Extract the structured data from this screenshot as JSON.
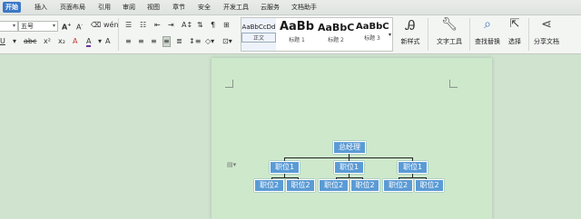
{
  "menu": {
    "items": [
      "开始",
      "插入",
      "页面布局",
      "引用",
      "审阅",
      "视图",
      "章节",
      "安全",
      "开发工具",
      "云服务",
      "文档助手"
    ],
    "active": "开始"
  },
  "ribbon": {
    "font_size": "五号",
    "styles": [
      {
        "preview": "AaBbCcDd",
        "label": "正文"
      },
      {
        "preview": "AaBb",
        "label": "标题 1"
      },
      {
        "preview": "AaBbC",
        "label": "标题 2"
      },
      {
        "preview": "AaBbC",
        "label": "标题 3"
      }
    ],
    "new_style": "新样式",
    "text_tools": "文字工具",
    "find_replace": "查找替换",
    "select": "选择",
    "share": "分享文档"
  },
  "org_chart": {
    "root": "总经理",
    "level1": [
      "职位1",
      "职位1",
      "职位1"
    ],
    "level2": [
      "职位2",
      "职位2",
      "职位2",
      "职位2",
      "职位2",
      "职位2"
    ]
  },
  "colors": {
    "node": "#5b9bd5",
    "page": "#cde8cb",
    "accent": "#3b78c7"
  }
}
